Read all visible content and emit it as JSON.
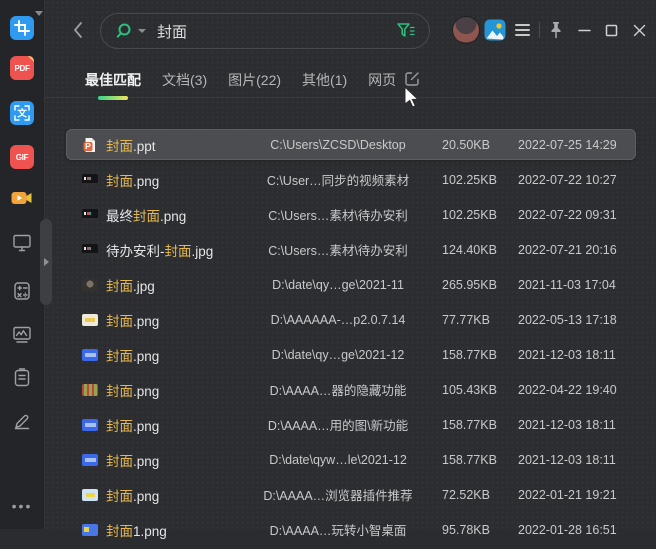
{
  "topbar": {
    "search": {
      "value": "封面"
    }
  },
  "tabs": {
    "items": [
      {
        "label": "最佳匹配",
        "active": true
      },
      {
        "label": "文档(3)",
        "active": false
      },
      {
        "label": "图片(22)",
        "active": false
      },
      {
        "label": "其他(1)",
        "active": false
      },
      {
        "label": "网页",
        "active": false
      }
    ]
  },
  "results": {
    "rows": [
      {
        "prefix": "",
        "match": "封面",
        "suffix": ".ppt",
        "path": "C:\\Users\\ZCSD\\Desktop",
        "size": "20.50KB",
        "date": "2022-07-25 14:29",
        "icon": "ppt",
        "selected": true
      },
      {
        "prefix": "",
        "match": "封面",
        "suffix": ".png",
        "path": "C:\\User…同步的视频素材",
        "size": "102.25KB",
        "date": "2022-07-22 10:27",
        "icon": "t-video",
        "selected": false
      },
      {
        "prefix": "最终",
        "match": "封面",
        "suffix": ".png",
        "path": "C:\\Users…素材\\待办安利",
        "size": "102.25KB",
        "date": "2022-07-22 09:31",
        "icon": "t-video",
        "selected": false
      },
      {
        "prefix": "待办安利-",
        "match": "封面",
        "suffix": ".jpg",
        "path": "C:\\Users…素材\\待办安利",
        "size": "124.40KB",
        "date": "2022-07-21 20:16",
        "icon": "t-video",
        "selected": false
      },
      {
        "prefix": "",
        "match": "封面",
        "suffix": ".jpg",
        "path": "D:\\date\\qy…ge\\2021-11",
        "size": "265.95KB",
        "date": "2021-11-03 17:04",
        "icon": "t-photo",
        "selected": false
      },
      {
        "prefix": "",
        "match": "封面",
        "suffix": ".png",
        "path": "D:\\AAAAAA-…p2.0.7.14",
        "size": "77.77KB",
        "date": "2022-05-13 17:18",
        "icon": "t-cream",
        "selected": false
      },
      {
        "prefix": "",
        "match": "封面",
        "suffix": ".png",
        "path": "D:\\date\\qy…ge\\2021-12",
        "size": "158.77KB",
        "date": "2021-12-03 18:11",
        "icon": "t-blue",
        "selected": false
      },
      {
        "prefix": "",
        "match": "封面",
        "suffix": ".png",
        "path": "D:\\AAAA…器的隐藏功能",
        "size": "105.43KB",
        "date": "2022-04-22 19:40",
        "icon": "t-green",
        "selected": false
      },
      {
        "prefix": "",
        "match": "封面",
        "suffix": ".png",
        "path": "D:\\AAAA…用的图\\新功能",
        "size": "158.77KB",
        "date": "2021-12-03 18:11",
        "icon": "t-blue",
        "selected": false
      },
      {
        "prefix": "",
        "match": "封面",
        "suffix": ".png",
        "path": "D:\\date\\qyw…le\\2021-12",
        "size": "158.77KB",
        "date": "2021-12-03 18:11",
        "icon": "t-blue",
        "selected": false
      },
      {
        "prefix": "",
        "match": "封面",
        "suffix": ".png",
        "path": "D:\\AAAA…浏览器插件推荐",
        "size": "72.52KB",
        "date": "2022-01-21 19:21",
        "icon": "t-lightblue",
        "selected": false
      },
      {
        "prefix": "",
        "match": "封面",
        "suffix": "1.png",
        "path": "D:\\AAAA…玩转小智桌面",
        "size": "95.78KB",
        "date": "2022-01-28 16:51",
        "icon": "t-blue2",
        "selected": false
      }
    ]
  },
  "sidebar": {
    "tools": [
      {
        "id": "screenshot",
        "label": ""
      },
      {
        "id": "pdf",
        "label": "PDF"
      },
      {
        "id": "translate",
        "label": "文"
      },
      {
        "id": "gif",
        "label": "GIF"
      },
      {
        "id": "video",
        "label": ""
      },
      {
        "id": "monitor",
        "label": ""
      },
      {
        "id": "calculator",
        "label": ""
      },
      {
        "id": "image-viewer",
        "label": ""
      },
      {
        "id": "clipboard",
        "label": ""
      },
      {
        "id": "pencil",
        "label": ""
      }
    ],
    "more_label": "•••"
  },
  "colors": {
    "accent_green": "#2bc17e",
    "highlight_yellow": "#e6b84f",
    "selected_row": "#4b4d50"
  }
}
